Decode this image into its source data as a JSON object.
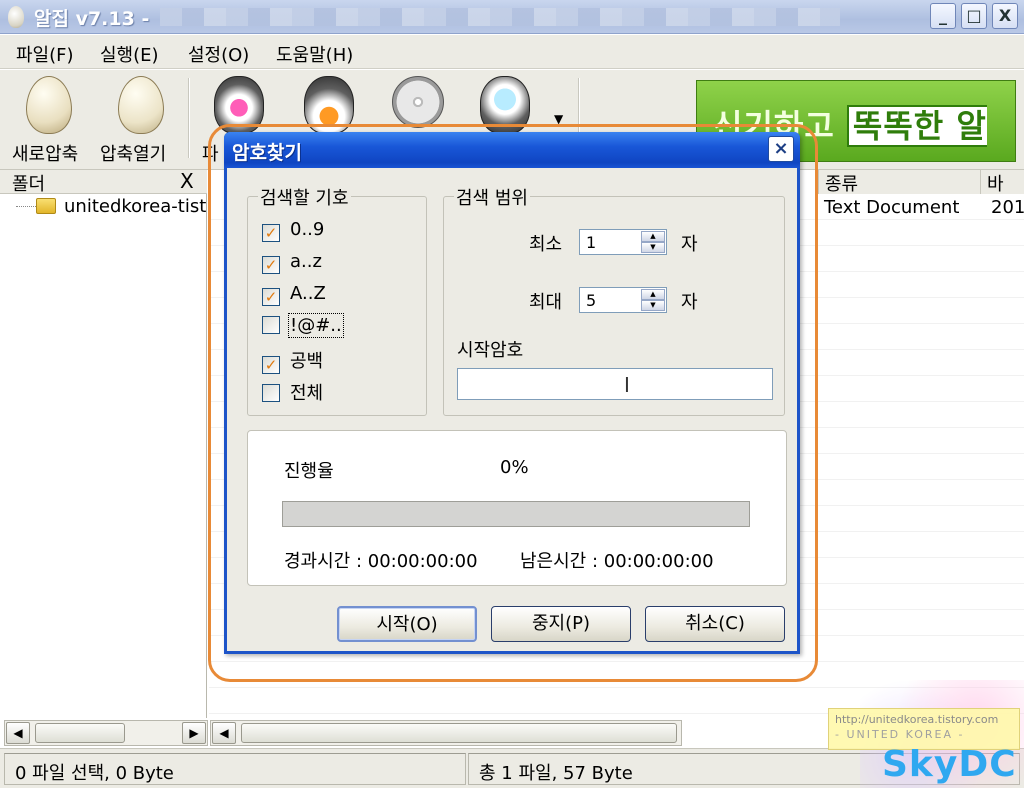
{
  "window": {
    "title": "알집 v7.13 -",
    "controls": [
      "_",
      "□",
      "X"
    ]
  },
  "menu": [
    {
      "label": "파일(F)",
      "name": "menu-file"
    },
    {
      "label": "실행(E)",
      "name": "menu-run"
    },
    {
      "label": "설정(O)",
      "name": "menu-settings"
    },
    {
      "label": "도움말(H)",
      "name": "menu-help"
    }
  ],
  "toolbar": {
    "new_archive": "새로압축",
    "open_archive": "압축열기",
    "partial_label": "파",
    "banner_text_1": "신기하고",
    "banner_text_2": "똑똑한 알송"
  },
  "folder_panel": {
    "header": "폴더",
    "close": "X",
    "tree_item": "unitedkorea-tist"
  },
  "file_list": {
    "columns": [
      "종류",
      "바"
    ],
    "rows": [
      [
        "Text Document",
        "201"
      ]
    ]
  },
  "status": {
    "left": "0 파일 선택,  0 Byte",
    "right": "총 1 파일,  57 Byte"
  },
  "dialog": {
    "title": "암호찾기",
    "close": "×",
    "symbols_group": "검색할 기호",
    "symbols": [
      {
        "label": "0..9",
        "checked": true
      },
      {
        "label": "a..z",
        "checked": true
      },
      {
        "label": "A..Z",
        "checked": true
      },
      {
        "label": "!@#..",
        "checked": false
      },
      {
        "label": "공백",
        "checked": true
      },
      {
        "label": "전체",
        "checked": false
      }
    ],
    "range_group": "검색 범위",
    "min_label": "최소",
    "min_value": "1",
    "max_label": "최대",
    "max_value": "5",
    "unit": "자",
    "start_pw_label": "시작암호",
    "start_pw_value": "",
    "progress_label": "진행율",
    "progress_value": "0%",
    "progress_fraction": 0,
    "elapsed": "경과시간 : 00:00:00:00",
    "remaining": "남은시간 : 00:00:00:00",
    "btn_start": "시작(O)",
    "btn_stop": "중지(P)",
    "btn_cancel": "취소(C)"
  },
  "watermark": {
    "url": "http://unitedkorea.tistory.com",
    "tag": "- UNITED KOREA -",
    "brand": "SkyDC"
  },
  "colors": {
    "dialog_title": "#1957d8",
    "highlight_ring": "#e88a37",
    "checkmark": "#e07a10",
    "banner": "#5aa91f",
    "brand": "#2fa8f0"
  }
}
